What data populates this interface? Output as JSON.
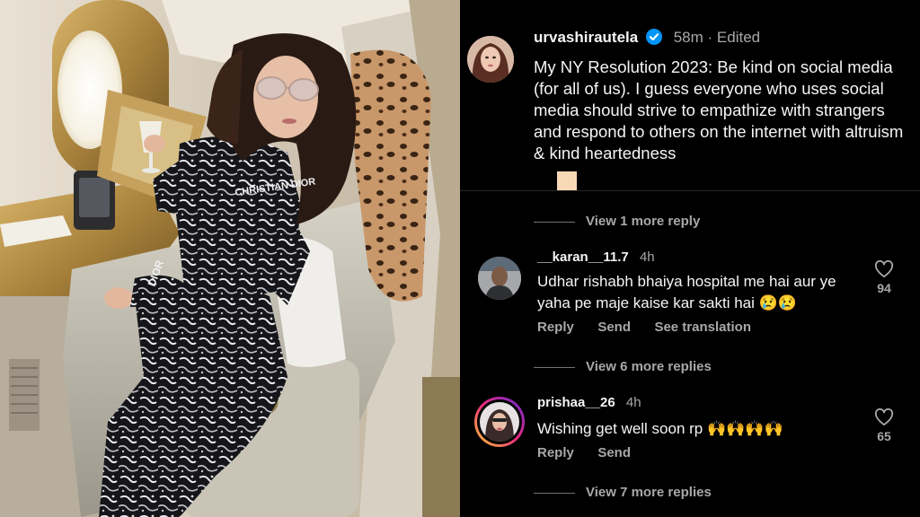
{
  "post": {
    "handle": "urvashirautela",
    "time": "58m",
    "edited": "Edited",
    "text": "My NY Resolution 2023: Be kind on social media (for all of us). I guess everyone who uses social media should strive to empathize with strangers and respond to others on the internet with altruism & kind heartedness",
    "view_more": "View 1 more reply"
  },
  "comments": [
    {
      "handle": "__karan__11.7",
      "time": "4h",
      "text_line1": "Udhar rishabh bhaiya hospital me hai aur ye",
      "text_line2": "yaha pe maje kaise kar sakti hai",
      "emoji": "😢😢",
      "reply": "Reply",
      "send": "Send",
      "translate": "See translation",
      "likes": "94",
      "view_more": "View 6 more replies"
    },
    {
      "handle": "prishaa__26",
      "time": "4h",
      "text": "Wishing get well soon rp",
      "emoji": "🙌🙌🙌🙌",
      "reply": "Reply",
      "send": "Send",
      "likes": "65",
      "view_more": "View 7 more replies"
    }
  ],
  "photo_print": {
    "text1": "CHRISTIAN DIOR",
    "text2": "CHRIS",
    "text3": "DIOR"
  },
  "colors": {
    "verified": "#0095f6",
    "muted": "#a8a8a8",
    "story_ring_start": "#f9ce34",
    "story_ring_end": "#c13584"
  }
}
